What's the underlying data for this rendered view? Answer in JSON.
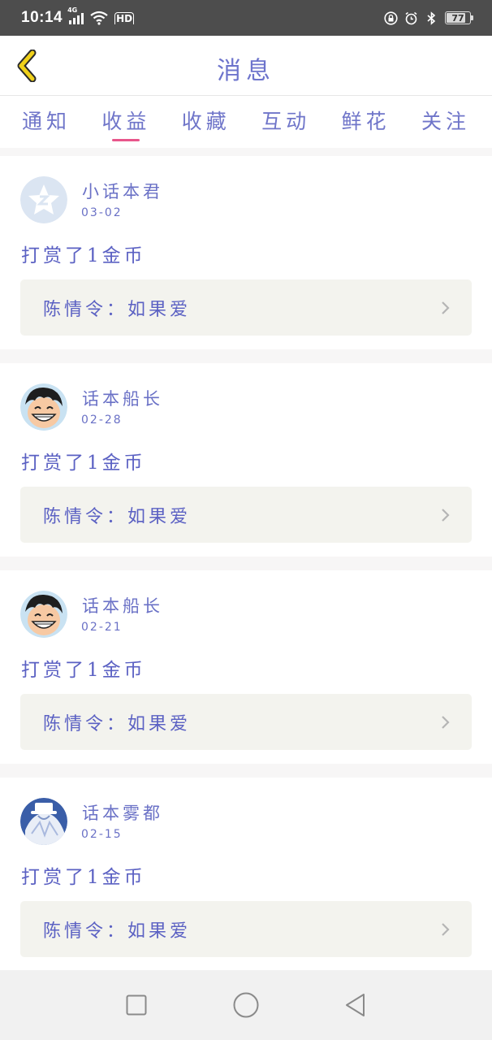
{
  "status_bar": {
    "time": "10:14",
    "network": "4G",
    "hd": "HD",
    "battery": "77"
  },
  "header": {
    "title": "消息"
  },
  "tabs": [
    {
      "label": "通知",
      "active": false
    },
    {
      "label": "收益",
      "active": true
    },
    {
      "label": "收藏",
      "active": false
    },
    {
      "label": "互动",
      "active": false
    },
    {
      "label": "鲜花",
      "active": false
    },
    {
      "label": "关注",
      "active": false
    }
  ],
  "messages": [
    {
      "name": "小话本君",
      "date": "03-02",
      "action": "打赏了1金币",
      "work": "陈情令：如果爱",
      "avatar": "default-star-avatar"
    },
    {
      "name": "话本船长",
      "date": "02-28",
      "action": "打赏了1金币",
      "work": "陈情令：如果爱",
      "avatar": "cartoon-boy-avatar"
    },
    {
      "name": "话本船长",
      "date": "02-21",
      "action": "打赏了1金币",
      "work": "陈情令：如果爱",
      "avatar": "cartoon-boy-avatar"
    },
    {
      "name": "话本雾都",
      "date": "02-15",
      "action": "打赏了1金币",
      "work": "陈情令：如果爱",
      "avatar": "white-caped-figure-avatar"
    }
  ],
  "colors": {
    "accent": "#e8568b",
    "text": "#5b61c3",
    "back_arrow": "#e8c800"
  }
}
